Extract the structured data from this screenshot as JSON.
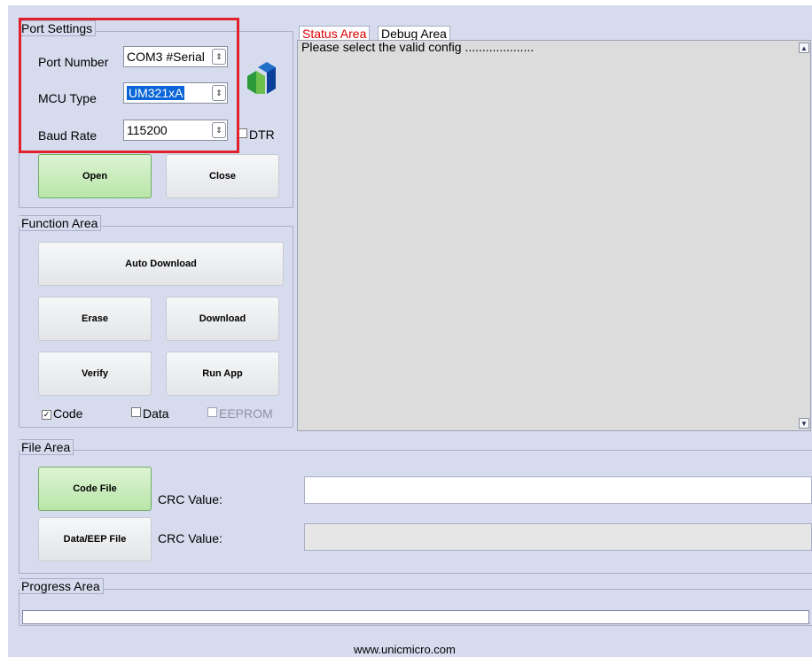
{
  "port_settings": {
    "title": "Port Settings",
    "port_number_label": "Port Number",
    "port_number_value": "COM3 #Serial",
    "mcu_type_label": "MCU Type",
    "mcu_type_value": "UM321xA",
    "baud_rate_label": "Baud Rate",
    "baud_rate_value": "115200",
    "dtr_label": "DTR",
    "open_label": "Open",
    "close_label": "Close"
  },
  "function_area": {
    "title": "Function Area",
    "auto_download_label": "Auto Download",
    "erase_label": "Erase",
    "download_label": "Download",
    "verify_label": "Verify",
    "run_app_label": "Run App",
    "code_label": "Code",
    "data_label": "Data",
    "eeprom_label": "EEPROM"
  },
  "tabs": {
    "status_area": "Status Area",
    "debug_area": "Debug Area"
  },
  "status": {
    "message": "Please select the valid config ...................."
  },
  "file_area": {
    "title": "File Area",
    "code_file_label": "Code File",
    "data_eep_file_label": "Data/EEP File",
    "crc_label_1": "CRC Value:",
    "crc_label_2": "CRC Value:"
  },
  "progress_area": {
    "title": "Progress Area"
  },
  "footer": {
    "url": "www.unicmicro.com"
  },
  "colors": {
    "background": "#d6dbee",
    "status_tab_text": "#e00000",
    "green_button": "#b9e6a8",
    "highlight": "#e0202a"
  }
}
